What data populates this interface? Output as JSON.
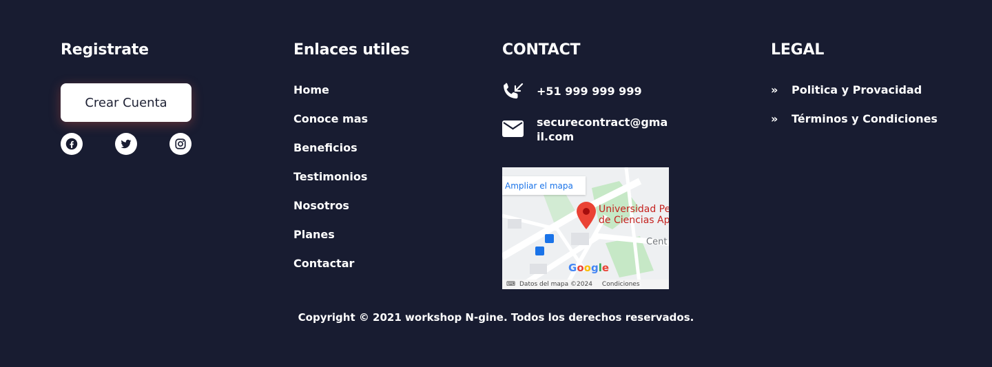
{
  "register": {
    "heading": "Registrate",
    "button_label": "Crear Cuenta",
    "socials": [
      {
        "icon": "facebook-icon"
      },
      {
        "icon": "twitter-icon"
      },
      {
        "icon": "instagram-icon"
      }
    ]
  },
  "links": {
    "heading": "Enlaces utiles",
    "items": [
      "Home",
      "Conoce mas",
      "Beneficios",
      "Testimonios",
      "Nosotros",
      "Planes",
      "Contactar"
    ]
  },
  "contact": {
    "heading": "CONTACT",
    "phone": "+51 999 999 999",
    "email": "securecontract@gmail.com",
    "map": {
      "expand_label": "Ampliar el mapa",
      "place_line1": "Universidad Pe",
      "place_line2": "de Ciencias Ap",
      "area_label": "Cent",
      "brand": "Google",
      "attribution": "Datos del mapa ©2024",
      "terms": "Condiciones"
    }
  },
  "legal": {
    "heading": "LEGAL",
    "items": [
      "Politica y Provacidad",
      "Términos y Condiciones"
    ]
  },
  "footer": {
    "copyright": "Copyright © 2021 workshop N-gine. Todos los derechos reservados."
  },
  "colors": {
    "background": "#181c31",
    "text": "#ffffff",
    "button_text": "#1d2033",
    "pin": "#ea4335"
  }
}
